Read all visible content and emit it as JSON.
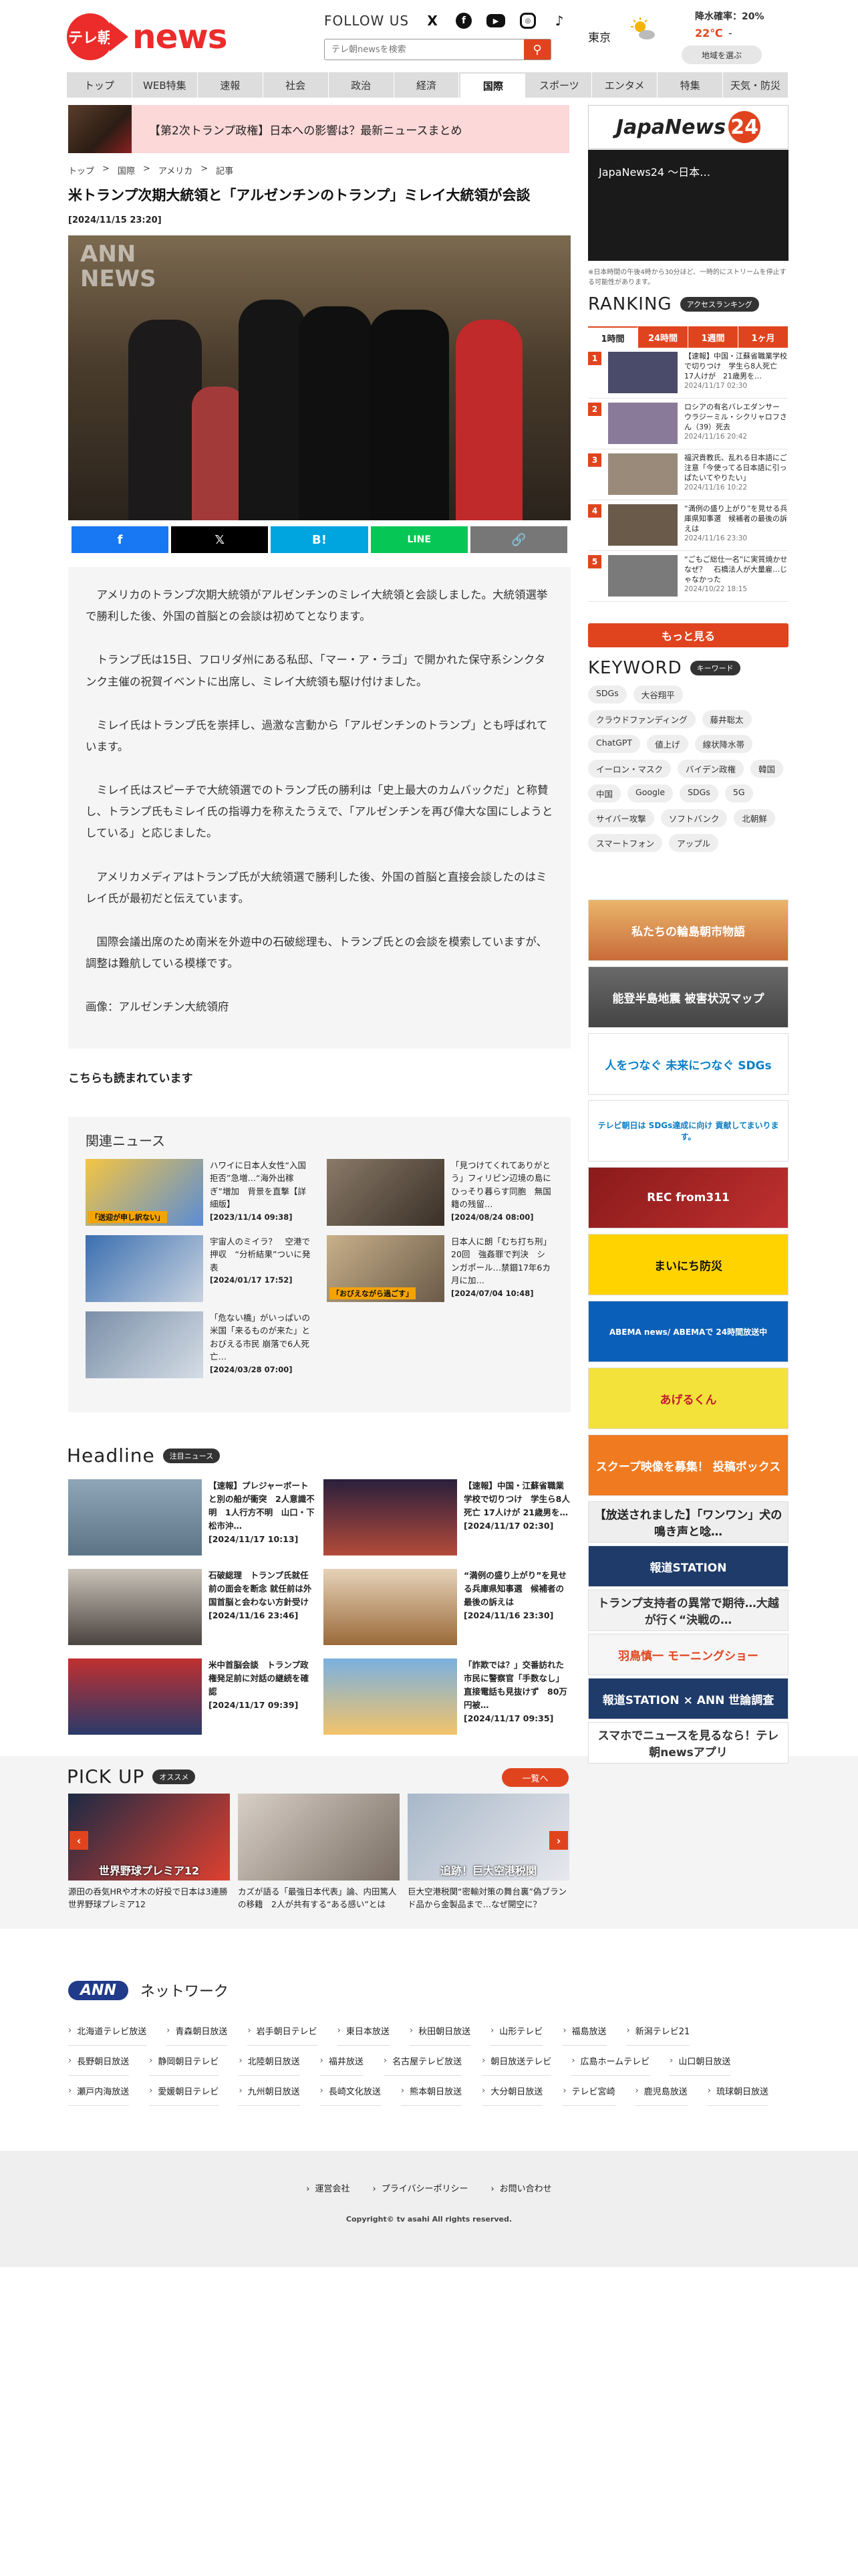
{
  "header": {
    "logo_tv": "テレ朝",
    "logo_news": "news",
    "follow_us": "FOLLOW US",
    "social": [
      "X",
      "f",
      "▶",
      "◎",
      "♪"
    ],
    "search_placeholder": "テレ朝newsを検索",
    "weather": {
      "area": "東京",
      "rain": "降水確率：20%",
      "temp_high": "22℃",
      "temp_sep": "-",
      "button": "地域を選ぶ"
    }
  },
  "nav": [
    "トップ",
    "WEB特集",
    "速報",
    "社会",
    "政治",
    "経済",
    "国際",
    "スポーツ",
    "エンタメ",
    "特集",
    "天気・防災"
  ],
  "nav_active_index": 6,
  "top_banner": "【第2次トランプ政権】日本への影響は？最新ニュースまとめ",
  "breadcrumb": [
    "トップ",
    ">",
    "国際",
    ">",
    "アメリカ",
    ">",
    "記事"
  ],
  "article": {
    "title": "米トランプ次期大統領と「アルゼンチンのトランプ」ミレイ大統領が会談",
    "date": "[2024/11/15 23:20]",
    "watermark": "ANN\nNEWS",
    "share": [
      "f",
      "𝕏",
      "B!",
      "LINE",
      "🔗"
    ],
    "paragraphs": [
      "アメリカのトランプ次期大統領がアルゼンチンのミレイ大統領と会談しました。大統領選挙で勝利した後、外国の首脳との会談は初めてとなります。",
      "トランプ氏は15日、フロリダ州にある私邸、「マー・ア・ラゴ」で開かれた保守系シンクタンク主催の祝賀イベントに出席し、ミレイ大統領も駆け付けました。",
      "ミレイ氏はトランプ氏を崇拝し、過激な言動から「アルゼンチンのトランプ」とも呼ばれています。",
      "ミレイ氏はスピーチで大統領選でのトランプ氏の勝利は「史上最大のカムバックだ」と称賛し、トランプ氏もミレイ氏の指導力を称えたうえで、「アルゼンチンを再び偉大な国にしようとしている」と応じました。",
      "アメリカメディアはトランプ氏が大統領選で勝利した後、外国の首脳と直接会談したのはミレイ氏が最初だと伝えています。",
      "国際会議出席のため南米を外遊中の石破総理も、トランプ氏との会談を模索していますが、調整は難航している模様です。"
    ],
    "credit": "画像：アルゼンチン大統領府"
  },
  "also_read": "こちらも読まれています",
  "related": {
    "title": "関連ニュース",
    "items": [
      {
        "text": "ハワイに日本人女性“入国拒否”急増…“海外出稼ぎ”増加　背景を直撃【詳細版】",
        "date": "[2023/11/14 09:38]",
        "thumb_label": "「送迎が申し訳ない」"
      },
      {
        "text": "「見つけてくれてありがとう」フィリピン辺境の島にひっそり暮らす同胞　無国籍の残留…",
        "date": "[2024/08/24 08:00]",
        "thumb_label": ""
      },
      {
        "text": "宇宙人のミイラ？　空港で押収　“分析結果”ついに発表",
        "date": "[2024/01/17 17:52]",
        "thumb_label": ""
      },
      {
        "text": "日本人に朗「むち打ち刑」20回　強姦罪で判決　シンガポール…禁錮17年6カ月に加…",
        "date": "[2024/07/04 10:48]",
        "thumb_label": "「おびえながら過ごす」"
      },
      {
        "text": "「危ない橋」がいっぱいの米国「来るものが来た」とおびえる市民 崩落で6人死亡…",
        "date": "[2024/03/28 07:00]",
        "thumb_label": ""
      }
    ]
  },
  "headline": {
    "title": "Headline",
    "badge": "注目ニュース",
    "items": [
      {
        "text": "【速報】プレジャーボートと別の船が衝突　2人意識不明　1人行方不明　山口・下松市沖…",
        "date": "[2024/11/17 10:13]"
      },
      {
        "text": "【速報】中国・江蘇省職業学校で切りつけ　学生ら8人死亡 17人けが 21歳男を…",
        "date": "[2024/11/17 02:30]"
      },
      {
        "text": "石破総理　トランプ氏就任前の面会を断念 就任前は外国首脳と会わない方針受け",
        "date": "[2024/11/16 23:46]"
      },
      {
        "text": "“満例の盛り上がり”を見せる兵庫県知事選　候補者の最後の訴えは",
        "date": "[2024/11/16 23:30]"
      },
      {
        "text": "米中首脳会談　トランプ政権発足前に対話の継続を確認",
        "date": "[2024/11/17 09:39]"
      },
      {
        "text": "「詐欺では？」交番訪れた市民に警察官「手数なし」直接電話も見抜けず　80万円被…",
        "date": "[2024/11/17 09:35]"
      }
    ]
  },
  "pickup": {
    "title": "PICK UP",
    "badge": "オススメ",
    "more": "一覧へ",
    "items": [
      {
        "text": "源田の呑気HRや才木の好投で日本は3連勝　世界野球プレミア12",
        "thumb_label": "世界野球プレミア12"
      },
      {
        "text": "カズが語る「最強日本代表」論、内田篤人の移籍　2人が共有する“ある感い”とは",
        "thumb_label": ""
      },
      {
        "text": "巨大空港税関“密輸対策の舞台裏”偽ブランド品から金製品まで…なぜ開空に？",
        "thumb_label": "追跡！巨大空港税関"
      }
    ]
  },
  "sidebar": {
    "japannews": "JapaNews",
    "japannews_num": "24",
    "video_title": "JapaNews24 ～日本…",
    "video_note": "※日本時間の午後4時から30分ほど、一時的にストリームを停止する可能性があります。",
    "ranking_title": "RANKING",
    "ranking_badge": "アクセスランキング",
    "ranking_tabs": [
      "1時間",
      "24時間",
      "1週間",
      "1ヶ月"
    ],
    "ranking": [
      {
        "num": "1",
        "text": "【速報】中国・江蘇省職業学校で切りつけ　学生ら8人死亡 17人けが　21歳男を…",
        "date": "2024/11/17 02:30"
      },
      {
        "num": "2",
        "text": "ロシアの有名バレエダンサー　ウラジーミル・シクリャロフさん（39）死去",
        "date": "2024/11/16 20:42"
      },
      {
        "num": "3",
        "text": "福沢貴教氏、乱れる日本語にご注意「今使ってる日本語に引っぱたいてやりたい」",
        "date": "2024/11/16 10:22"
      },
      {
        "num": "4",
        "text": "“満例の盛り上がり”を見せる兵庫県知事選　候補者の最後の訴えは",
        "date": "2024/11/16 23:30"
      },
      {
        "num": "5",
        "text": "“ごもご総仕一名”に実質焼かせ　なぜ？　石橋法人が大量雇…じゃなかった",
        "date": "2024/10/22 18:15"
      }
    ],
    "more": "もっと見る",
    "keyword_title": "KEYWORD",
    "keyword_badge": "キーワード",
    "keywords": [
      "SDGs",
      "大谷翔平",
      "クラウドファンディング",
      "藤井聡太",
      "ChatGPT",
      "値上げ",
      "線状降水帯",
      "イーロン・マスク",
      "バイデン政権",
      "韓国",
      "中国",
      "Google",
      "SDGs",
      "5G",
      "サイバー攻撃",
      "ソフトバンク",
      "北朝鮮",
      "スマートフォン",
      "アップル"
    ],
    "banners": [
      "私たちの輪島朝市物語",
      "能登半島地震 被害状況マップ",
      "人をつなぐ 未来につなぐ SDGs",
      "テレビ朝日は SDGs達成に向け 貢献してまいります。",
      "REC from311",
      "まいにち防災",
      "ABEMA news/ ABEMAで 24時間放送中",
      "あげるくん",
      "スクープ映像を募集！ 投稿ボックス",
      "【放送されました】「ワンワン」犬の鳴き声と唸…",
      "報道STATION",
      "トランプ支持者の異常で期待…大越が行く“決戦の…",
      "羽鳥慎一 モーニングショー",
      "報道STATION × ANN 世論調査",
      "スマホでニュースを見るなら！テレ朝newsアプリ"
    ]
  },
  "network": {
    "title": "ネットワーク",
    "logo": "ANN",
    "stations": [
      "北海道テレビ放送",
      "青森朝日放送",
      "岩手朝日テレビ",
      "東日本放送",
      "秋田朝日放送",
      "山形テレビ",
      "福島放送",
      "新潟テレビ21",
      "長野朝日放送",
      "静岡朝日テレビ",
      "北陸朝日放送",
      "福井放送",
      "名古屋テレビ放送",
      "朝日放送テレビ",
      "広島ホームテレビ",
      "山口朝日放送",
      "瀬戸内海放送",
      "愛媛朝日テレビ",
      "九州朝日放送",
      "長崎文化放送",
      "熊本朝日放送",
      "大分朝日放送",
      "テレビ宮崎",
      "鹿児島放送",
      "琉球朝日放送"
    ]
  },
  "footer": {
    "links": [
      "運営会社",
      "プライバシーポリシー",
      "お問い合わせ"
    ],
    "copyright": "Copyright© tv asahi All rights reserved."
  },
  "colors": {
    "brand": "#ec2b2b",
    "accent": "#e0441e",
    "ann": "#1f3b8a"
  }
}
